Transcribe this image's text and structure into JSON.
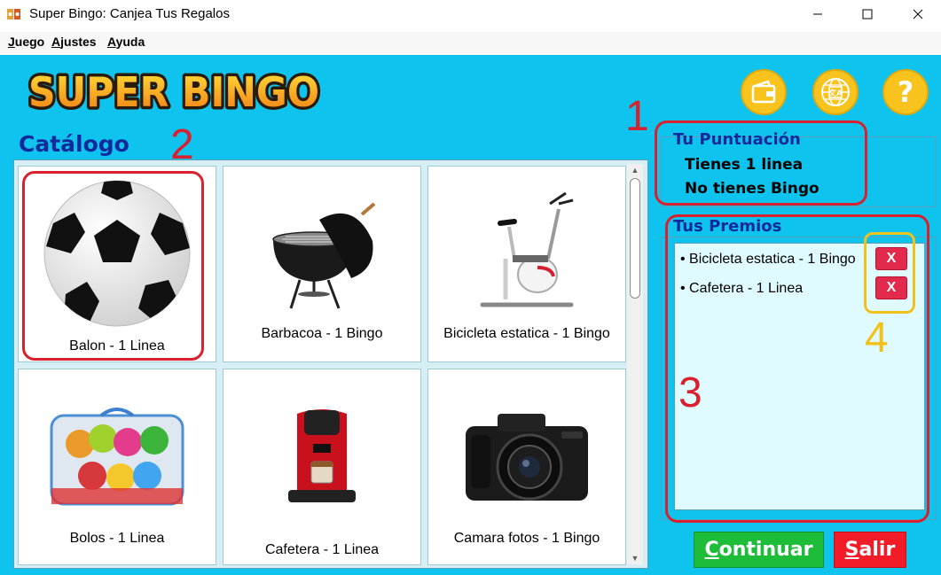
{
  "window": {
    "title": "Super Bingo: Canjea Tus Regalos",
    "controls": [
      "minimize-icon",
      "maximize-icon",
      "close-icon"
    ]
  },
  "menu": [
    {
      "mnemonic": "J",
      "rest": "uego"
    },
    {
      "mnemonic": "A",
      "rest": "justes"
    },
    {
      "mnemonic": "A",
      "rest": "yuda"
    }
  ],
  "header": {
    "logo_text": "SUPER BINGO",
    "icons": [
      "wallet-icon",
      "language-globe-icon",
      "help-icon"
    ],
    "help_glyph": "?"
  },
  "catalog": {
    "title": "Catálogo",
    "items": [
      {
        "label": "Balon - 1 Linea",
        "image": "soccer-ball-image"
      },
      {
        "label": "Barbacoa - 1 Bingo",
        "image": "barbecue-grill-image"
      },
      {
        "label": "Bicicleta estatica - 1 Bingo",
        "image": "exercise-bike-image"
      },
      {
        "label": "Bolos - 1 Linea",
        "image": "toy-bowling-set-image"
      },
      {
        "label": "Cafetera - 1 Linea",
        "image": "coffee-machine-image"
      },
      {
        "label": "Camara fotos - 1 Bingo",
        "image": "camera-image"
      }
    ],
    "scroll_up": "▲",
    "scroll_down": "▼"
  },
  "score": {
    "title": "Tu Puntuación",
    "line1": "Tienes 1 linea",
    "line2": "No tienes Bingo"
  },
  "prizes": {
    "title": "Tus Premios",
    "items": [
      {
        "label": "• Bicicleta estatica - 1 Bingo",
        "remove_label": "X"
      },
      {
        "label": "• Cafetera - 1 Linea",
        "remove_label": "X"
      }
    ]
  },
  "actions": {
    "continue_mnemonic": "C",
    "continue_rest": "ontinuar",
    "exit_mnemonic": "S",
    "exit_rest": "alir"
  },
  "annotations": [
    "1",
    "2",
    "3",
    "4"
  ],
  "colors": {
    "background": "#0ec4ee",
    "title_text": "#102a9c",
    "continue_button": "#1ebd39",
    "exit_button": "#f21c29",
    "remove_button": "#e32a4c",
    "annotation_red": "#d9202e",
    "annotation_yellow": "#f1c21b"
  }
}
